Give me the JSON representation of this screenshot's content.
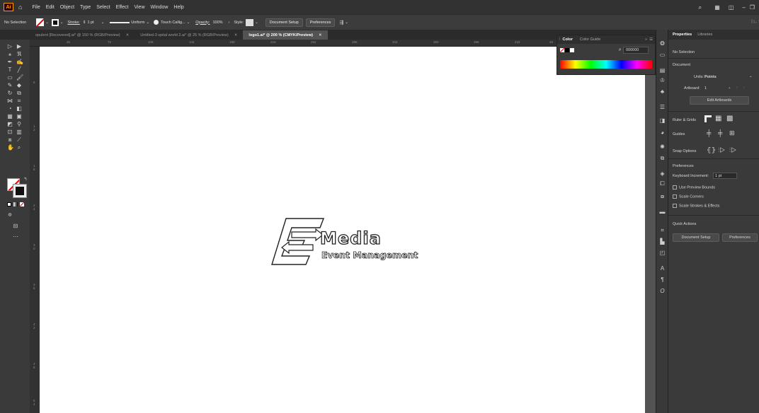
{
  "menubar": {
    "items": [
      "File",
      "Edit",
      "Object",
      "Type",
      "Select",
      "Effect",
      "View",
      "Window",
      "Help"
    ],
    "logo": "Ai"
  },
  "control": {
    "selection": "No Selection",
    "stroke_label": "Stroke:",
    "stroke_value": "1 pt",
    "profile": "Uniform",
    "brush": "Touch Callig...",
    "opacity_label": "Opacity:",
    "opacity_value": "100%",
    "style_label": "Style:",
    "doc_setup": "Document Setup",
    "preferences": "Preferences"
  },
  "tabs": [
    {
      "label": "opulent [Recovered].ai* @ 150 % (RGB/Preview)",
      "active": false
    },
    {
      "label": "Untitled-3 spital world 2.ai* @ 25 % (RGB/Preview)",
      "active": false
    },
    {
      "label": "logo1.ai* @ 200 % (CMYK/Preview)",
      "active": true
    }
  ],
  "ruler": {
    "h_ticks": [
      "36",
      "72",
      "108",
      "144",
      "180",
      "216",
      "252",
      "288",
      "324",
      "360",
      "396",
      "432",
      "46"
    ],
    "v_ticks": [
      "6",
      "1\n2",
      "1\n8",
      "2\n4",
      "3\n0",
      "3\n6",
      "4\n2",
      "4\n8",
      "5\n4",
      "6\n0"
    ]
  },
  "color_panel": {
    "tab_color": "Color",
    "tab_guide": "Color Guide",
    "hex_label": "#",
    "hex_value": "000000"
  },
  "logo": {
    "word": "Media",
    "tagline": "Event Management"
  },
  "properties": {
    "tab_properties": "Properties",
    "tab_libraries": "Libraries",
    "no_selection": "No Selection",
    "document": "Document",
    "units_label": "Units:",
    "units_value": "Points",
    "artboard_label": "Artboard:",
    "artboard_value": "1",
    "edit_artboards": "Edit Artboards",
    "ruler_grids": "Ruler & Grids",
    "guides": "Guides",
    "snap_options": "Snap Options",
    "preferences": "Preferences",
    "keyboard_increment_label": "Keyboard Increment:",
    "keyboard_increment_value": "1 pt",
    "use_preview_bounds": "Use Preview Bounds",
    "scale_corners": "Scale Corners",
    "scale_strokes": "Scale Strokes & Effects",
    "quick_actions": "Quick Actions",
    "doc_setup_btn": "Document Setup",
    "prefs_btn": "Preferences"
  },
  "colors": {
    "accent": "#ff9a00",
    "chrome_dark": "#323232",
    "panel": "#3a3a3a"
  }
}
